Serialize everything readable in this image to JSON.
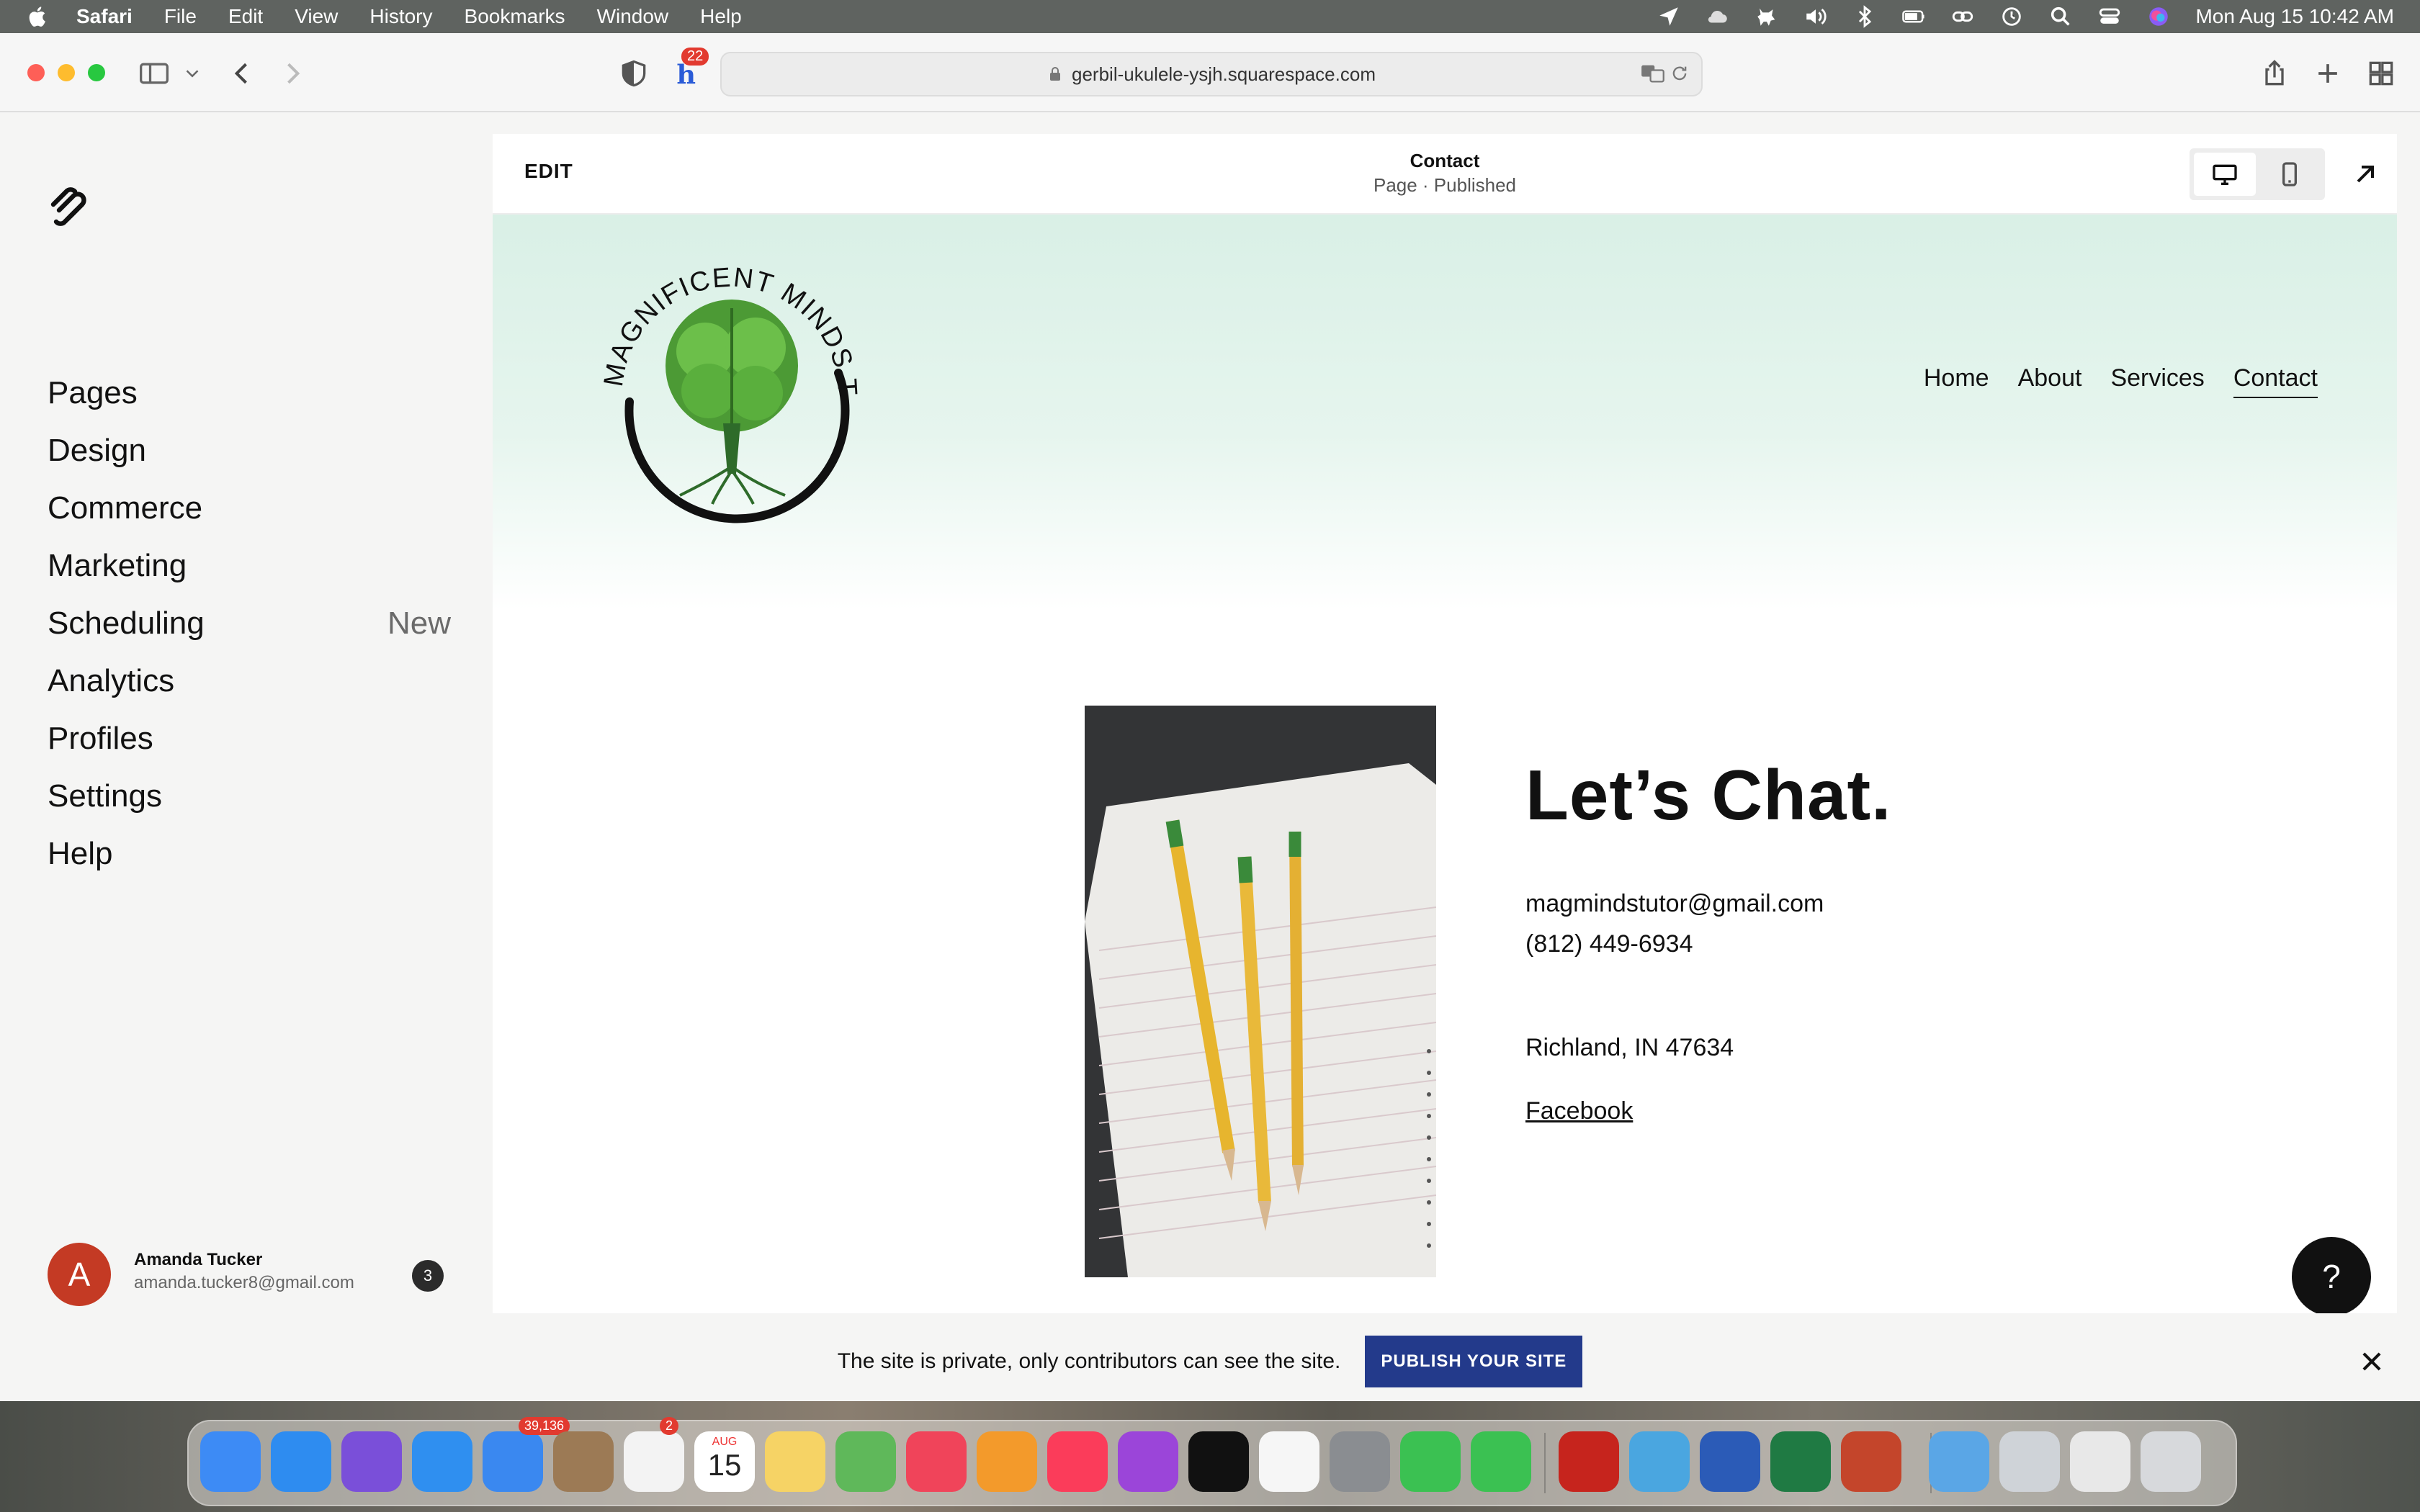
{
  "menubar": {
    "app_name": "Safari",
    "items": [
      "File",
      "Edit",
      "View",
      "History",
      "Bookmarks",
      "Window",
      "Help"
    ],
    "clock": "Mon Aug 15  10:42 AM",
    "status_icons": [
      "location-icon",
      "cloud-icon",
      "dog-icon",
      "volume-icon",
      "bluetooth-icon",
      "battery-icon",
      "link-icon",
      "time-machine-icon",
      "search-icon",
      "control-center-icon",
      "siri-icon"
    ]
  },
  "browser": {
    "url": "gerbil-ukulele-ysjh.squarespace.com",
    "honey_badge": "22"
  },
  "sidebar": {
    "items": [
      {
        "label": "Pages",
        "badge": ""
      },
      {
        "label": "Design",
        "badge": ""
      },
      {
        "label": "Commerce",
        "badge": ""
      },
      {
        "label": "Marketing",
        "badge": ""
      },
      {
        "label": "Scheduling",
        "badge": "New"
      },
      {
        "label": "Analytics",
        "badge": ""
      },
      {
        "label": "Profiles",
        "badge": ""
      },
      {
        "label": "Settings",
        "badge": ""
      },
      {
        "label": "Help",
        "badge": ""
      }
    ],
    "user": {
      "initial": "A",
      "name": "Amanda Tucker",
      "email": "amanda.tucker8@gmail.com",
      "notifications": "3"
    }
  },
  "editor": {
    "edit_label": "EDIT",
    "page_title": "Contact",
    "page_status": "Page · Published"
  },
  "site": {
    "logo_text": "MAGNIFICENT MINDS TUTORING",
    "nav": [
      "Home",
      "About",
      "Services",
      "Contact"
    ],
    "current_nav": "Contact",
    "heading": "Let’s Chat.",
    "email": "magmindstutor@gmail.com",
    "phone": "(812) 449-6934",
    "location": "Richland, IN 47634",
    "facebook": "Facebook",
    "help_fab": "?"
  },
  "banner": {
    "text": "The site is private, only contributors can see the site.",
    "button": "PUBLISH YOUR SITE"
  },
  "dock": {
    "mail_badge": "39,136",
    "reminders_badge": "2",
    "calendar_month": "AUG",
    "calendar_day": "15",
    "apps": [
      "finder-icon",
      "app-store-icon",
      "siri-icon",
      "safari-icon",
      "mail-icon",
      "contacts-icon",
      "reminders-icon",
      "calendar-icon",
      "notes-icon",
      "maps-icon",
      "news-icon",
      "books-icon",
      "music-icon",
      "podcasts-icon",
      "apple-tv-icon",
      "photos-icon",
      "system-preferences-icon",
      "facetime-icon",
      "messages-icon",
      "acrobat-icon",
      "dog-app-icon",
      "word-icon",
      "excel-icon",
      "powerpoint-icon",
      "folder-icon",
      "screenshot-icon",
      "screenshot-icon-2",
      "trash-icon"
    ],
    "colors": [
      "#3d8bf5",
      "#2e8cf0",
      "#7a4fd9",
      "#2f8ff0",
      "#3a88f0",
      "#9c7a55",
      "#f3f3f3",
      "#ffffff",
      "#f6d365",
      "#5fb85a",
      "#f0445a",
      "#f39a2b",
      "#fb3c5a",
      "#9b45d9",
      "#111111",
      "#f6f6f6",
      "#8a8d91",
      "#3bc152",
      "#3bc152",
      "#c6241d",
      "#4aa6e0",
      "#2b5bb7",
      "#1f7a43",
      "#c4452b",
      "#5aa6e6",
      "#cfd3d8",
      "#e8e8e8",
      "#d7d9dc"
    ]
  },
  "colors": {
    "publish_button": "#233a8b",
    "avatar": "#c43a24",
    "site_header_tint": "#d9f0e6"
  }
}
